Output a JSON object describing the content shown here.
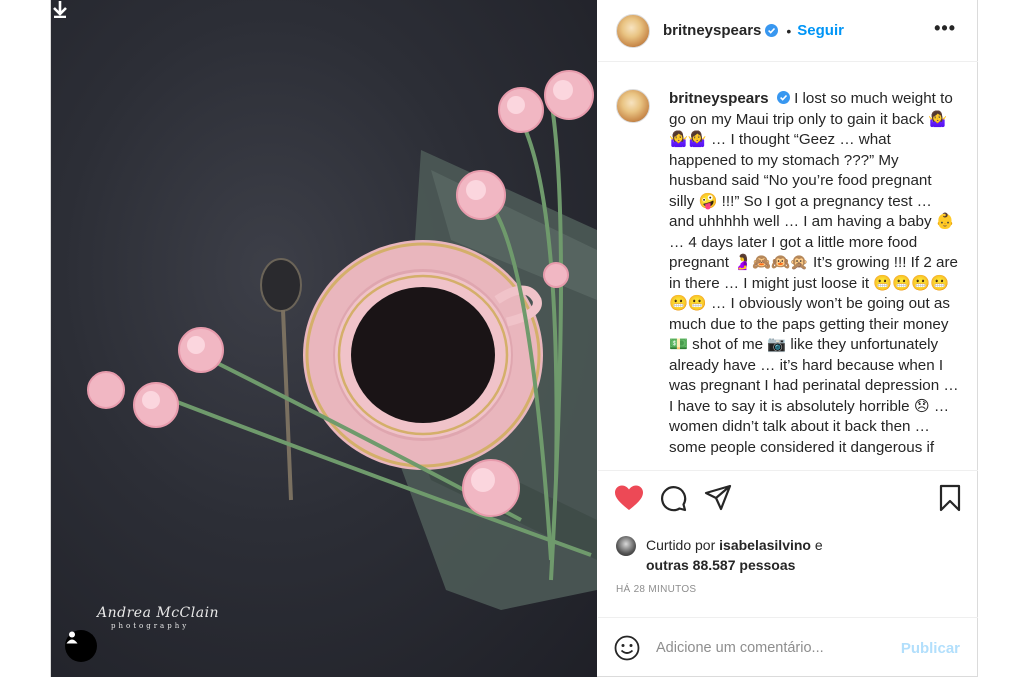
{
  "post": {
    "username": "britneyspears",
    "follow_label": "Seguir",
    "dot": "•",
    "more_label": "•••",
    "caption_username": "britneyspears",
    "caption_text": "I lost so much weight to go on my Maui trip only to gain it back 🤷‍♀️🤷‍♀️🤷‍♀️ … I thought “Geez … what happened to my stomach ???” My husband said “No you’re food pregnant silly 🤪 !!!” So I got a pregnancy test … and uhhhhh well … I am having a baby 👶 … 4 days later I got a little more food pregnant 🤰🙈🙉🙊 It’s growing !!! If 2 are in there … I might just loose it 😬😬😬😬😬😬 … I obviously won’t be going out as much due to the paps getting their money 💵 shot of me 📷 like they unfortunately already have … it’s hard because when I was pregnant I had perinatal depression … I have to say it is absolutely horrible 😞 … women didn’t talk about it back then … some people considered it dangerous if"
  },
  "likes": {
    "prefix": "Curtido por ",
    "user": "isabelasilvino",
    "conj": " e",
    "others": "outras 88.587 pessoas"
  },
  "time_ago": "HÁ 28 MINUTOS",
  "comment": {
    "placeholder": "Adicione um comentário...",
    "publish_label": "Publicar"
  },
  "photo": {
    "watermark_name": "Andrea McClain",
    "watermark_sub": "photography"
  },
  "icons": {
    "download": "download-arrow-icon",
    "user_tag": "user-tag-icon",
    "verified": "verified-badge-icon",
    "like": "heart-filled-icon",
    "comment": "comment-bubble-icon",
    "share": "paper-plane-icon",
    "save": "bookmark-icon",
    "emoji": "smiley-icon"
  },
  "colors": {
    "like_red": "#ed4956",
    "link_blue": "#0095f6",
    "publish_disabled": "#b2dffc",
    "verified_blue": "#3897f0"
  }
}
